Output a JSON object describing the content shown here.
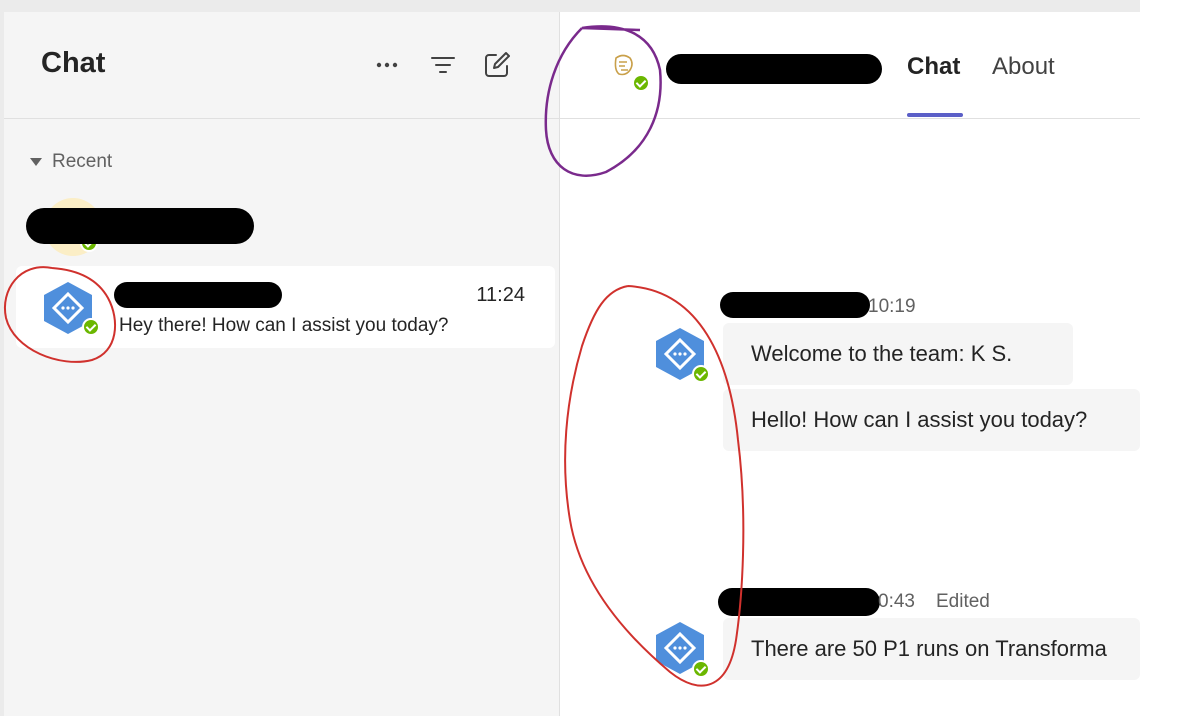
{
  "left_pane": {
    "title": "Chat",
    "more_icon": "more-options-icon",
    "filter_icon": "filter-icon",
    "compose_icon": "new-chat-icon",
    "section": {
      "label": "Recent",
      "icon": "caret-down-icon"
    },
    "conversations": [
      {
        "name": "",
        "time": "",
        "preview": "",
        "status": "available"
      },
      {
        "name": "",
        "time": "11:24",
        "preview": "Hey there! How can I assist you today?",
        "status": "available"
      }
    ]
  },
  "right_pane": {
    "contact_name": "",
    "tabs": [
      {
        "label": "Chat",
        "active": true
      },
      {
        "label": "About",
        "active": false
      }
    ],
    "messages": [
      {
        "time": "10:19",
        "edited": "",
        "texts": [
          "Welcome to the team: K S.",
          "Hello! How can I assist you today?"
        ]
      },
      {
        "time": "0:43",
        "edited": "Edited",
        "texts": [
          "There are 50 P1 runs on Transforma"
        ]
      }
    ]
  },
  "colors": {
    "accent": "#5b5fc7",
    "presence_available": "#6bb700",
    "bot_icon": "#4f8fdc",
    "annotation_red": "#d0312d",
    "annotation_purple": "#7a2a8c"
  }
}
